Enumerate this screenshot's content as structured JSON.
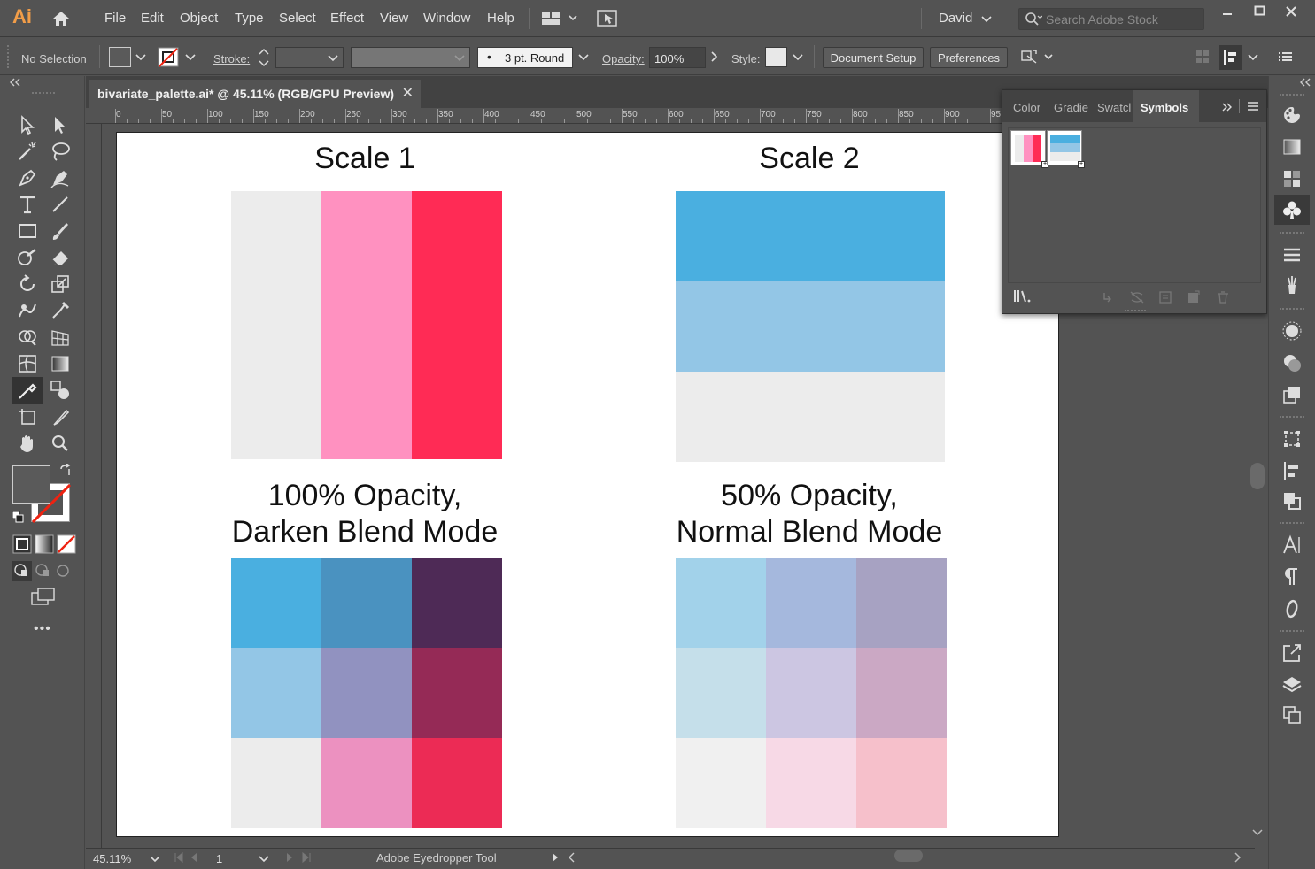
{
  "app": {
    "logo": "Ai",
    "user": "David",
    "search_placeholder": "Search Adobe Stock"
  },
  "menu": [
    "File",
    "Edit",
    "Object",
    "Type",
    "Select",
    "Effect",
    "View",
    "Window",
    "Help"
  ],
  "control": {
    "selection": "No Selection",
    "stroke_label": "Stroke:",
    "brush": "3 pt. Round",
    "opacity_label": "Opacity:",
    "opacity_value": "100%",
    "style_label": "Style:",
    "document_setup": "Document Setup",
    "preferences": "Preferences"
  },
  "document": {
    "tab_title": "bivariate_palette.ai* @ 45.11% (RGB/GPU Preview)",
    "close_glyph": "✕"
  },
  "ruler_h": [
    "0",
    "50",
    "100",
    "150",
    "200",
    "250",
    "300",
    "350",
    "400",
    "450",
    "500",
    "550",
    "600",
    "650",
    "700",
    "750",
    "800",
    "850",
    "900",
    "95"
  ],
  "artboard": {
    "scale1_title": "Scale 1",
    "scale2_title": "Scale 2",
    "darken_title_line1": "100% Opacity,",
    "darken_title_line2": "Darken Blend Mode",
    "normal_title_line1": "50% Opacity,",
    "normal_title_line2": "Normal Blend Mode",
    "scale1_colors": [
      "#ececec",
      "#ff91c0",
      "#ff2b55"
    ],
    "scale2_colors": [
      "#4aafe0",
      "#93c6e6",
      "#ececec"
    ],
    "darken_grid": [
      [
        "#4aafe0",
        "#4a92c0",
        "#4e2a56"
      ],
      [
        "#93c6e6",
        "#9192c0",
        "#952a56"
      ],
      [
        "#ececec",
        "#ec91c0",
        "#ec2b55"
      ]
    ],
    "normal_grid": [
      [
        "#a2d2ea",
        "#a5b8dd",
        "#a7a2c2"
      ],
      [
        "#c5dfea",
        "#ccc6e2",
        "#cba8c4"
      ],
      [
        "#f0f0f0",
        "#f7d9e6",
        "#f6c0cb"
      ]
    ]
  },
  "symbols_panel": {
    "tabs": [
      "Color",
      "Gradie",
      "Swatcl",
      "Symbols"
    ],
    "active_tab": "Symbols"
  },
  "status": {
    "zoom": "45.11%",
    "page": "1",
    "tool": "Adobe Eyedropper Tool"
  }
}
